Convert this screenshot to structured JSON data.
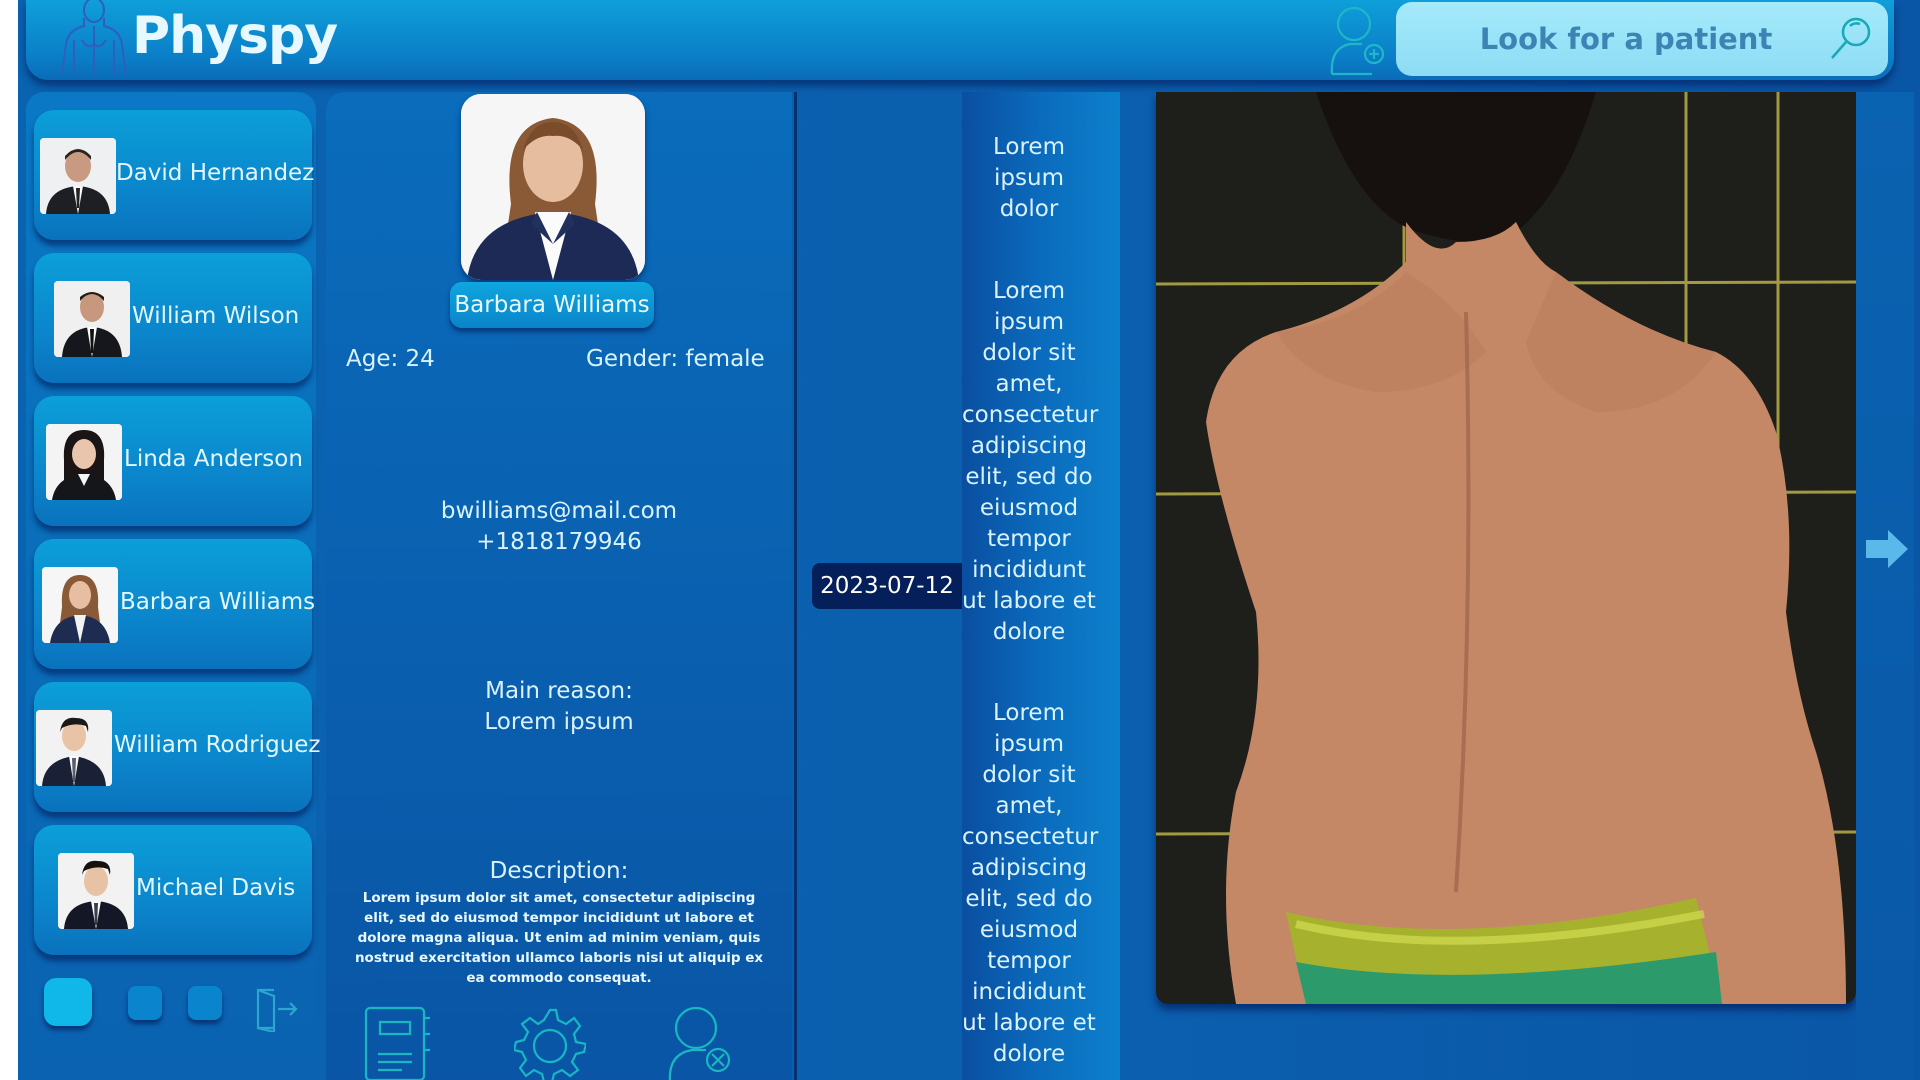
{
  "app": {
    "title": "Physpy"
  },
  "search": {
    "placeholder": "Look for a patient"
  },
  "sidebar": {
    "patients": [
      {
        "name": "David Hernandez"
      },
      {
        "name": "William Wilson"
      },
      {
        "name": "Linda Anderson"
      },
      {
        "name": "Barbara Williams"
      },
      {
        "name": "William Rodriguez"
      },
      {
        "name": "Michael Davis"
      }
    ]
  },
  "patient": {
    "name": "Barbara Williams",
    "age": "Age: 24",
    "gender": "Gender: female",
    "email": "bwilliams@mail.com",
    "phone": "+1818179946",
    "reason_label": "Main reason:",
    "reason_value": "Lorem ipsum",
    "description_label": "Description:",
    "description_text": "Lorem ipsum dolor sit amet, consectetur adipiscing elit, sed do eiusmod tempor incididunt ut labore et dolore magna aliqua. Ut enim ad minim veniam, quis nostrud exercitation ullamco laboris nisi ut aliquip ex ea commodo consequat."
  },
  "timeline": {
    "date": "2023-07-12",
    "note_1": "Lorem ipsum dolor",
    "note_2": "Lorem ipsum dolor sit amet, consectetur adipiscing elit, sed do eiusmod tempor incididunt ut labore et dolore",
    "note_3": "Lorem ipsum dolor sit amet, consectetur adipiscing elit, sed do eiusmod tempor incididunt ut labore et dolore"
  },
  "colors": {
    "primary": "#0a63b0",
    "header": "#0b7fc8",
    "search_bg": "#a6eafb",
    "accent_icon": "#17c4b8",
    "date_badge": "#041f5a"
  },
  "icons": [
    "body-logo-icon",
    "add-patient-icon",
    "search-icon",
    "logout-icon",
    "notes-icon",
    "settings-icon",
    "remove-patient-icon",
    "next-arrow-icon"
  ]
}
